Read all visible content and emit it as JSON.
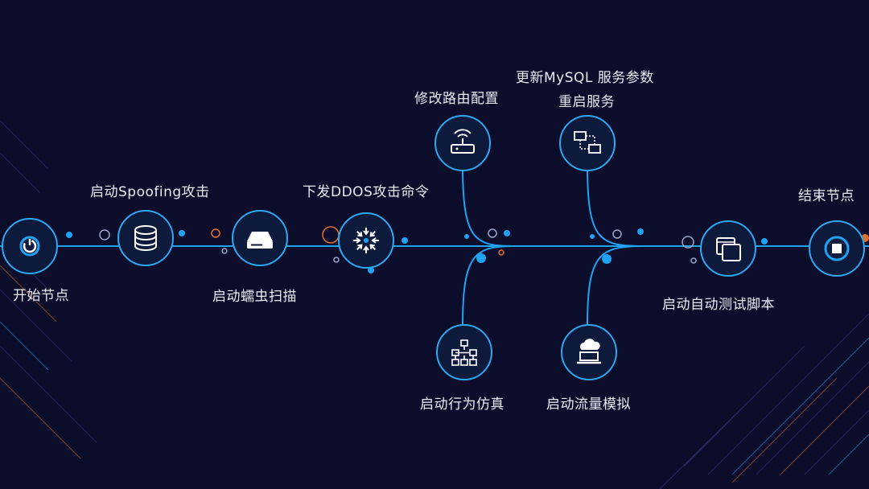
{
  "colors": {
    "background": "#0b0d2b",
    "line": "#1ea3f5",
    "node_fill": "#0e1a3c",
    "node_ring": "#2da8f2",
    "icon": "#ffffff",
    "accent_orange": "#e0702a",
    "dot_blue": "#1ea3f5"
  },
  "nodes": {
    "start": {
      "label": "开始节点",
      "icon": "power-icon"
    },
    "spoof": {
      "label": "启动Spoofing攻击",
      "icon": "database-icon"
    },
    "worm": {
      "label": "启动蠕虫扫描",
      "icon": "hard-drive-icon"
    },
    "ddos": {
      "label": "下发DDOS攻击命令",
      "icon": "converge-arrows-icon"
    },
    "router": {
      "label": "修改路由配置",
      "icon": "router-icon"
    },
    "mysql": {
      "label": "更新MySQL 服务参数",
      "label2": "重启服务",
      "icon": "network-computers-icon"
    },
    "behavior": {
      "label": "启动行为仿真",
      "icon": "flowchart-icon"
    },
    "traffic": {
      "label": "启动流量模拟",
      "icon": "cloud-laptop-icon"
    },
    "test": {
      "label": "启动自动测试脚本",
      "icon": "windows-icon"
    },
    "end": {
      "label": "结束节点",
      "icon": "stop-icon"
    }
  }
}
